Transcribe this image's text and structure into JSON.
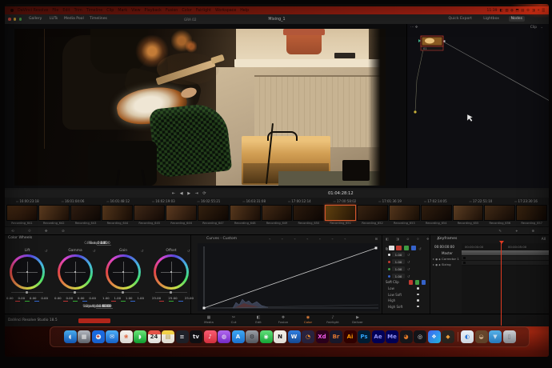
{
  "menu_bar": {
    "items": [
      {
        "t": "DaVinci Resolve"
      },
      {
        "t": "File"
      },
      {
        "t": "Edit"
      },
      {
        "t": "Trim"
      },
      {
        "t": "Timeline"
      },
      {
        "t": "Clip"
      },
      {
        "t": "Mark"
      },
      {
        "t": "View"
      },
      {
        "t": "Playback"
      },
      {
        "t": "Fusion"
      },
      {
        "t": "Color"
      },
      {
        "t": "Fairlight"
      },
      {
        "t": "Workspace"
      },
      {
        "t": "Help"
      }
    ],
    "clock": "11:39",
    "status_icons": [
      {
        "g": "◧"
      },
      {
        "g": "▥"
      },
      {
        "g": "◍"
      },
      {
        "g": "⬒"
      },
      {
        "g": "▤"
      },
      {
        "g": "⚙"
      },
      {
        "g": "◨"
      },
      {
        "g": "✦"
      },
      {
        "g": "▒"
      }
    ]
  },
  "window": {
    "title": "Mixing_1",
    "gallery": "Gallery",
    "luts": "LUTs",
    "media_pool": "Media Pool",
    "timelines": "Timelines",
    "timeline_badge": "GRA 02",
    "quick_export": "Quick Export",
    "lightbox": "Lightbox",
    "nodes_toggle": "Nodes"
  },
  "nodes_panel": {
    "clip_label": "Clip",
    "node_label": "01"
  },
  "viewer": {
    "timecode": "01:04:28:12",
    "transport": "⇤ ◀ ▶ ⇥ ⟳"
  },
  "timeline": {
    "ruler": [
      {
        "tc": "16:00:23:18"
      },
      {
        "tc": "16:01:04:06"
      },
      {
        "tc": "16:01:48:12"
      },
      {
        "tc": "16:02:19:03"
      },
      {
        "tc": "16:02:55:21"
      },
      {
        "tc": "16:03:31:08"
      },
      {
        "tc": "17:00:12:14"
      },
      {
        "tc": "17:00:58:02"
      },
      {
        "tc": "17:01:36:19"
      },
      {
        "tc": "17:02:14:05"
      },
      {
        "tc": "17:22:51:10"
      },
      {
        "tc": "17:23:30:16"
      }
    ],
    "clips": [
      {
        "name": "Recording_641",
        "bg": "linear-gradient(135deg,#4a2c14,#140a05)"
      },
      {
        "name": "Recording_642",
        "bg": "linear-gradient(120deg,#5a3a1e,#1a0e06)"
      },
      {
        "name": "Recording_643",
        "bg": "linear-gradient(135deg,#2e1c10,#0d0704)"
      },
      {
        "name": "Recording_644",
        "bg": "linear-gradient(110deg,#51341a,#170c05)"
      },
      {
        "name": "Recording_645",
        "bg": "linear-gradient(135deg,#3f2817,#120905)"
      },
      {
        "name": "Recording_646",
        "bg": "linear-gradient(125deg,#5c3a20,#1c1008)"
      },
      {
        "name": "Recording_647",
        "bg": "linear-gradient(135deg,#33200f,#0e0703)"
      },
      {
        "name": "Recording_648",
        "bg": "linear-gradient(115deg,#56371c,#180d06)"
      },
      {
        "name": "Recording_649",
        "bg": "linear-gradient(135deg,#422915,#130a04)"
      },
      {
        "name": "Recording_650",
        "bg": "linear-gradient(130deg,#2b1a0d,#0c0603)"
      },
      {
        "name": "Recording_651",
        "bg": "linear-gradient(115deg,#60400f,#241505)",
        "selected": true
      },
      {
        "name": "Recording_652",
        "bg": "linear-gradient(135deg,#382312,#100803)"
      },
      {
        "name": "Recording_653",
        "bg": "linear-gradient(120deg,#53351b,#170d05)"
      },
      {
        "name": "Recording_654",
        "bg": "linear-gradient(135deg,#2f1d0e,#0d0704)"
      },
      {
        "name": "Recording_655",
        "bg": "linear-gradient(125deg,#5b3d22,#1b0f07)"
      },
      {
        "name": "Recording_656",
        "bg": "linear-gradient(135deg,#412a16,#120a05)"
      },
      {
        "name": "Recording_657",
        "bg": "linear-gradient(120deg,#36220f,#0f0804)"
      }
    ]
  },
  "wheels": {
    "title": "Color Wheels",
    "adjust_top": [
      {
        "label": "Temp",
        "value": "0.0"
      },
      {
        "label": "Tint",
        "value": "0.00"
      },
      {
        "label": "Contrast",
        "value": "1.000"
      },
      {
        "label": "Pivot",
        "value": "0.435"
      }
    ],
    "lift": {
      "name": "Lift",
      "v1": "0.00",
      "v2": "0.00",
      "v3": "0.00",
      "v4": "0.00"
    },
    "gamma": {
      "name": "Gamma",
      "v1": "0.00",
      "v2": "0.00",
      "v3": "0.00",
      "v4": "0.00"
    },
    "gain": {
      "name": "Gain",
      "v1": "1.00",
      "v2": "1.00",
      "v3": "1.00",
      "v4": "1.00"
    },
    "offset": {
      "name": "Offset",
      "v1": "25.00",
      "v2": "25.00",
      "v3": "25.00"
    },
    "adjust_bottom": [
      {
        "label": "Shadows",
        "value": "0.00"
      },
      {
        "label": "Highlights",
        "value": "0.00"
      },
      {
        "label": "Saturation",
        "value": "50.00"
      },
      {
        "label": "Hue",
        "value": "50.00"
      },
      {
        "label": "Lum Mix",
        "value": "100.00"
      }
    ]
  },
  "curves": {
    "title": "Curves - Custom",
    "gains": [
      {
        "dot": "#e8e8e8",
        "value": "1.00"
      },
      {
        "dot": "#c23b31",
        "value": "1.00"
      },
      {
        "dot": "#3f9b42",
        "value": "1.00"
      },
      {
        "dot": "#3562c9",
        "value": "1.00"
      }
    ],
    "soft_clip_title": "Soft Clip",
    "soft_clip_rows": [
      {
        "label": "Low"
      },
      {
        "label": "Low Soft"
      },
      {
        "label": "High"
      },
      {
        "label": "High Soft"
      }
    ]
  },
  "keyframes": {
    "title": "Keyframes",
    "all_label": "All",
    "timecode": "00:00:00:00",
    "master": "Master",
    "tracks": [
      {
        "label": "Corrector 1"
      },
      {
        "label": "Sizing"
      }
    ],
    "ruler_start": "00:00:00:00",
    "ruler_mid": "00:00:05:00"
  },
  "footer": {
    "version": "DaVinci Resolve Studio 18.5",
    "pages": [
      {
        "label": "Media",
        "icon": "▦"
      },
      {
        "label": "Cut",
        "icon": "✂"
      },
      {
        "label": "Edit",
        "icon": "◧"
      },
      {
        "label": "Fusion",
        "icon": "❖"
      },
      {
        "label": "Color",
        "icon": "◉",
        "active": true
      },
      {
        "label": "Fairlight",
        "icon": "♪"
      },
      {
        "label": "Deliver",
        "icon": "▶"
      }
    ]
  },
  "colors": {
    "accent_orange": "#e8823a",
    "selection_red": "#d4552a",
    "playhead_red": "#e03a22",
    "menubar_red": "#a82113"
  },
  "dock": {
    "items": [
      {
        "n": "finder-icon",
        "g": "◖",
        "bg": "linear-gradient(180deg,#4db5f9,#1565cf)",
        "fg": "#eef6ff"
      },
      {
        "n": "launchpad-icon",
        "g": "▦",
        "bg": "linear-gradient(180deg,#b9bec6,#6e737c)",
        "fg": "#fafafa"
      },
      {
        "n": "safari-icon",
        "g": "✦",
        "bg": "radial-gradient(circle,#eef7ff 26%,#1b6ee8 30%)",
        "fg": "#d23b2f"
      },
      {
        "n": "mail-icon",
        "g": "✉",
        "bg": "linear-gradient(180deg,#4fb1f8,#1a6fe0)",
        "fg": "#ffffff"
      },
      {
        "n": "photos-icon",
        "g": "❀",
        "bg": "#f5f2ec",
        "fg": "#e8633a"
      },
      {
        "n": "messages-icon",
        "g": "◗",
        "bg": "linear-gradient(180deg,#6de87b,#12ad35)",
        "fg": "#ffffff"
      },
      {
        "n": "calendar-icon",
        "g": "24",
        "bg": "linear-gradient(180deg,#e8564a 30%,#f6f4f0 30%)",
        "fg": "#333333"
      },
      {
        "n": "notes-icon",
        "g": "▤",
        "bg": "linear-gradient(180deg,#f7d64a 30%,#f5f1e6 30%)",
        "fg": "#b79a2e"
      },
      {
        "n": "reminders-icon",
        "g": "≡",
        "bg": "#20222a",
        "fg": "#e8e8ec"
      },
      {
        "n": "tv-icon",
        "g": "tv",
        "bg": "#101014",
        "fg": "#f2f2f5"
      },
      {
        "n": "music-icon",
        "g": "♪",
        "bg": "linear-gradient(180deg,#fb5d73,#e53543)",
        "fg": "#ffffff"
      },
      {
        "n": "podcasts-icon",
        "g": "◍",
        "bg": "linear-gradient(180deg,#b36af0,#7f2fd8)",
        "fg": "#ffffff"
      },
      {
        "n": "app-store-icon",
        "g": "A",
        "bg": "linear-gradient(180deg,#3fa9f5,#1d7de2)",
        "fg": "#ffffff"
      },
      {
        "n": "settings-icon",
        "g": "⚙",
        "bg": "linear-gradient(180deg,#9ba0a8,#5c6068)",
        "fg": "#2e3033"
      },
      {
        "n": "facetime-icon",
        "g": "◉",
        "bg": "linear-gradient(180deg,#63e07c,#18b43c)",
        "fg": "#ffffff"
      },
      {
        "n": "notion-icon",
        "g": "N",
        "bg": "#f4f1ea",
        "fg": "#17161a"
      },
      {
        "n": "word-icon",
        "g": "W",
        "bg": "linear-gradient(180deg,#2f7fe3,#174f9e)",
        "fg": "#ffffff"
      },
      {
        "n": "firefox-icon",
        "g": "◔",
        "bg": "#2a2440",
        "fg": "#ff9a2e"
      },
      {
        "n": "adobe-xd-icon",
        "g": "Xd",
        "bg": "#2e001e",
        "fg": "#ff61f6"
      },
      {
        "n": "adobe-bridge-icon",
        "g": "Br",
        "bg": "#1a1a2e",
        "fg": "#e77b34"
      },
      {
        "n": "adobe-illustrator-icon",
        "g": "Ai",
        "bg": "#330000",
        "fg": "#ff9a00"
      },
      {
        "n": "adobe-photoshop-icon",
        "g": "Ps",
        "bg": "#001e36",
        "fg": "#31a8ff"
      },
      {
        "n": "adobe-after-effects-icon",
        "g": "Ae",
        "bg": "#00005b",
        "fg": "#9999ff"
      },
      {
        "n": "adobe-media-encoder-icon",
        "g": "Me",
        "bg": "#00005b",
        "fg": "#9999ff"
      },
      {
        "n": "davinci-resolve-icon",
        "g": "◕",
        "bg": "#17181c",
        "fg": "#e87d2b"
      },
      {
        "n": "watch-icon",
        "g": "◎",
        "bg": "#141418",
        "fg": "#e8e8ea"
      },
      {
        "n": "shortcuts-icon",
        "g": "❖",
        "bg": "linear-gradient(135deg,#3e65f2,#27c4f5)",
        "fg": "#ffffff"
      },
      {
        "n": "handbrake-icon",
        "g": "◆",
        "bg": "#2c2620",
        "fg": "#f0a23c"
      },
      {
        "n": "dock-divider",
        "divider": true
      },
      {
        "n": "quicktime-icon",
        "g": "◐",
        "bg": "#e9f2fb",
        "fg": "#2f7fe3"
      },
      {
        "n": "beaver-app-icon",
        "g": "◒",
        "bg": "#6b4a2e",
        "fg": "#d8b48e"
      },
      {
        "n": "downloads-folder-icon",
        "g": "▼",
        "bg": "linear-gradient(180deg,#59b7f0,#2c8cd8)",
        "fg": "#cfeaff"
      },
      {
        "n": "trash-icon",
        "g": "▯",
        "bg": "linear-gradient(180deg,#d6d9de,#9aa0a8)",
        "fg": "#777c84"
      }
    ]
  }
}
